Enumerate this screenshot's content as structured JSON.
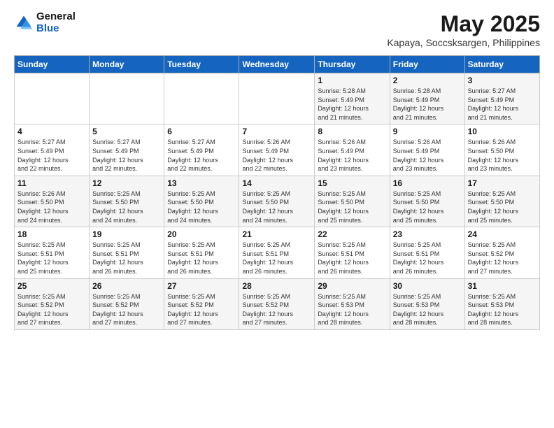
{
  "header": {
    "logo_general": "General",
    "logo_blue": "Blue",
    "title": "May 2025",
    "location": "Kapaya, Soccsksargen, Philippines"
  },
  "weekdays": [
    "Sunday",
    "Monday",
    "Tuesday",
    "Wednesday",
    "Thursday",
    "Friday",
    "Saturday"
  ],
  "weeks": [
    [
      {
        "day": "",
        "info": ""
      },
      {
        "day": "",
        "info": ""
      },
      {
        "day": "",
        "info": ""
      },
      {
        "day": "",
        "info": ""
      },
      {
        "day": "1",
        "info": "Sunrise: 5:28 AM\nSunset: 5:49 PM\nDaylight: 12 hours\nand 21 minutes."
      },
      {
        "day": "2",
        "info": "Sunrise: 5:28 AM\nSunset: 5:49 PM\nDaylight: 12 hours\nand 21 minutes."
      },
      {
        "day": "3",
        "info": "Sunrise: 5:27 AM\nSunset: 5:49 PM\nDaylight: 12 hours\nand 21 minutes."
      }
    ],
    [
      {
        "day": "4",
        "info": "Sunrise: 5:27 AM\nSunset: 5:49 PM\nDaylight: 12 hours\nand 22 minutes."
      },
      {
        "day": "5",
        "info": "Sunrise: 5:27 AM\nSunset: 5:49 PM\nDaylight: 12 hours\nand 22 minutes."
      },
      {
        "day": "6",
        "info": "Sunrise: 5:27 AM\nSunset: 5:49 PM\nDaylight: 12 hours\nand 22 minutes."
      },
      {
        "day": "7",
        "info": "Sunrise: 5:26 AM\nSunset: 5:49 PM\nDaylight: 12 hours\nand 22 minutes."
      },
      {
        "day": "8",
        "info": "Sunrise: 5:26 AM\nSunset: 5:49 PM\nDaylight: 12 hours\nand 23 minutes."
      },
      {
        "day": "9",
        "info": "Sunrise: 5:26 AM\nSunset: 5:49 PM\nDaylight: 12 hours\nand 23 minutes."
      },
      {
        "day": "10",
        "info": "Sunrise: 5:26 AM\nSunset: 5:50 PM\nDaylight: 12 hours\nand 23 minutes."
      }
    ],
    [
      {
        "day": "11",
        "info": "Sunrise: 5:26 AM\nSunset: 5:50 PM\nDaylight: 12 hours\nand 24 minutes."
      },
      {
        "day": "12",
        "info": "Sunrise: 5:25 AM\nSunset: 5:50 PM\nDaylight: 12 hours\nand 24 minutes."
      },
      {
        "day": "13",
        "info": "Sunrise: 5:25 AM\nSunset: 5:50 PM\nDaylight: 12 hours\nand 24 minutes."
      },
      {
        "day": "14",
        "info": "Sunrise: 5:25 AM\nSunset: 5:50 PM\nDaylight: 12 hours\nand 24 minutes."
      },
      {
        "day": "15",
        "info": "Sunrise: 5:25 AM\nSunset: 5:50 PM\nDaylight: 12 hours\nand 25 minutes."
      },
      {
        "day": "16",
        "info": "Sunrise: 5:25 AM\nSunset: 5:50 PM\nDaylight: 12 hours\nand 25 minutes."
      },
      {
        "day": "17",
        "info": "Sunrise: 5:25 AM\nSunset: 5:50 PM\nDaylight: 12 hours\nand 25 minutes."
      }
    ],
    [
      {
        "day": "18",
        "info": "Sunrise: 5:25 AM\nSunset: 5:51 PM\nDaylight: 12 hours\nand 25 minutes."
      },
      {
        "day": "19",
        "info": "Sunrise: 5:25 AM\nSunset: 5:51 PM\nDaylight: 12 hours\nand 26 minutes."
      },
      {
        "day": "20",
        "info": "Sunrise: 5:25 AM\nSunset: 5:51 PM\nDaylight: 12 hours\nand 26 minutes."
      },
      {
        "day": "21",
        "info": "Sunrise: 5:25 AM\nSunset: 5:51 PM\nDaylight: 12 hours\nand 26 minutes."
      },
      {
        "day": "22",
        "info": "Sunrise: 5:25 AM\nSunset: 5:51 PM\nDaylight: 12 hours\nand 26 minutes."
      },
      {
        "day": "23",
        "info": "Sunrise: 5:25 AM\nSunset: 5:51 PM\nDaylight: 12 hours\nand 26 minutes."
      },
      {
        "day": "24",
        "info": "Sunrise: 5:25 AM\nSunset: 5:52 PM\nDaylight: 12 hours\nand 27 minutes."
      }
    ],
    [
      {
        "day": "25",
        "info": "Sunrise: 5:25 AM\nSunset: 5:52 PM\nDaylight: 12 hours\nand 27 minutes."
      },
      {
        "day": "26",
        "info": "Sunrise: 5:25 AM\nSunset: 5:52 PM\nDaylight: 12 hours\nand 27 minutes."
      },
      {
        "day": "27",
        "info": "Sunrise: 5:25 AM\nSunset: 5:52 PM\nDaylight: 12 hours\nand 27 minutes."
      },
      {
        "day": "28",
        "info": "Sunrise: 5:25 AM\nSunset: 5:52 PM\nDaylight: 12 hours\nand 27 minutes."
      },
      {
        "day": "29",
        "info": "Sunrise: 5:25 AM\nSunset: 5:53 PM\nDaylight: 12 hours\nand 28 minutes."
      },
      {
        "day": "30",
        "info": "Sunrise: 5:25 AM\nSunset: 5:53 PM\nDaylight: 12 hours\nand 28 minutes."
      },
      {
        "day": "31",
        "info": "Sunrise: 5:25 AM\nSunset: 5:53 PM\nDaylight: 12 hours\nand 28 minutes."
      }
    ]
  ]
}
